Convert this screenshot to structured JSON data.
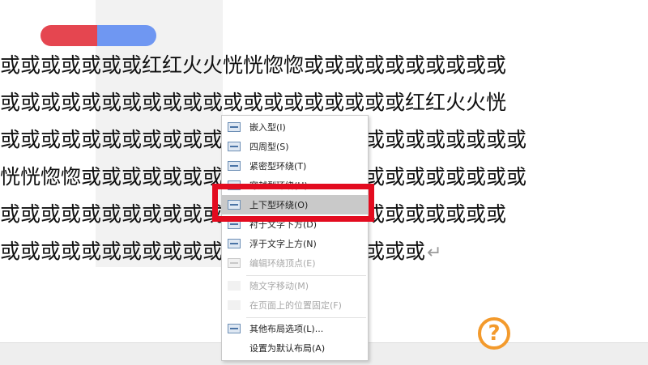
{
  "colors": {
    "pill_left": "#e54650",
    "pill_right": "#6f97f2",
    "highlight_frame": "#e30b1f",
    "help_accent": "#f39a2c"
  },
  "document": {
    "lines": [
      "或或或或或或或红红火火恍恍惚惚或或或或或或或或或或",
      "或或或或或或或或或或或或或或或或或或或或红红火火恍",
      "或或或或或或或或或或或或或或或或或或或或或或或或或或",
      "恍恍惚惚或或或或或或或或或或或或或或或或或或或或或或",
      "或或或或或或或或或或或或或或恍惚惚或或或或或或或或",
      "或或或或或或或或或或或或或或或或或或或或或"
    ],
    "return_mark": "↵"
  },
  "help_icon_glyph": "?",
  "context_menu": {
    "items": [
      {
        "label": "嵌入型(I)",
        "icon": "inline-wrap-icon"
      },
      {
        "label": "四周型(S)",
        "icon": "square-wrap-icon"
      },
      {
        "label": "紧密型环绕(T)",
        "icon": "tight-wrap-icon"
      },
      {
        "label": "穿越型环绕(H)",
        "icon": "through-wrap-icon"
      },
      {
        "label": "上下型环绕(O)",
        "icon": "top-bottom-wrap-icon"
      },
      {
        "label": "衬于文字下方(D)",
        "icon": "behind-text-icon"
      },
      {
        "label": "浮于文字上方(N)",
        "icon": "in-front-of-text-icon"
      },
      {
        "label": "编辑环绕顶点(E)",
        "icon": "edit-wrap-points-icon"
      },
      {
        "label": "随文字移动(M)",
        "icon": ""
      },
      {
        "label": "在页面上的位置固定(F)",
        "icon": ""
      },
      {
        "label": "其他布局选项(L)...",
        "icon": "more-layout-options-icon"
      },
      {
        "label": "设置为默认布局(A)",
        "icon": ""
      }
    ]
  }
}
